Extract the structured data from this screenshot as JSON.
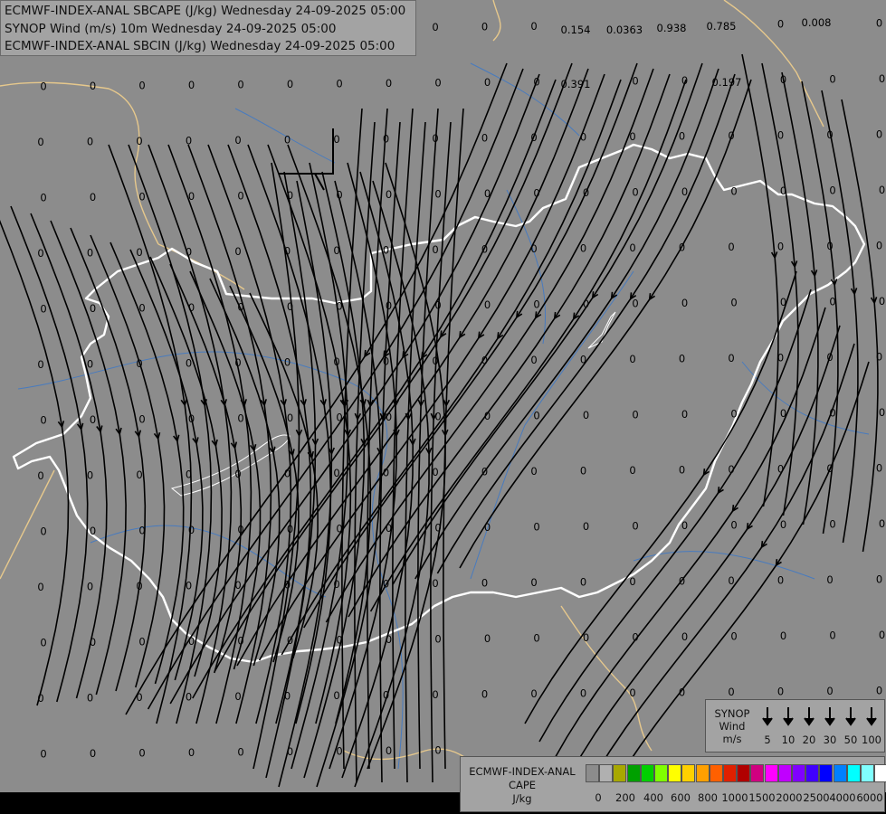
{
  "header": {
    "lines": [
      "ECMWF-INDEX-ANAL SBCAPE (J/kg) Wednesday 24-09-2025 05:00",
      "SYNOP Wind (m/s) 10m Wednesday 24-09-2025 05:00",
      "ECMWF-INDEX-ANAL SBCIN (J/kg) Wednesday 24-09-2025 05:00"
    ]
  },
  "wind_legend": {
    "title_lines": [
      "SYNOP",
      "Wind",
      "m/s"
    ],
    "speeds": [
      "5",
      "10",
      "20",
      "30",
      "50",
      "100"
    ]
  },
  "cape_legend": {
    "title_lines": [
      "ECMWF-INDEX-ANAL",
      "CAPE",
      "J/kg"
    ],
    "ticks": [
      "0",
      "200",
      "400",
      "600",
      "800",
      "1000",
      "1500",
      "2000",
      "2500",
      "4000",
      "6000"
    ],
    "colors": [
      "#8c8c8c",
      "#b0b0b0",
      "#a8a800",
      "#00a000",
      "#00d000",
      "#80ff00",
      "#ffff00",
      "#ffd000",
      "#ffa000",
      "#ff6000",
      "#e02000",
      "#b00000",
      "#d00080",
      "#ff00ff",
      "#c000ff",
      "#8000ff",
      "#4000ff",
      "#0000ff",
      "#0080ff",
      "#00ffff",
      "#80ffff",
      "#ffffff"
    ]
  },
  "map": {
    "colors": {
      "background": "#8c8c8c",
      "country_border": "#ffffff",
      "neighbor_border": "#e6c88c",
      "river": "#3c78c8",
      "streamline": "#000000",
      "bottom_strip": "#000000"
    },
    "value_labels": [
      "0",
      "0.154",
      "0.0363",
      "0.938",
      "0.785",
      "0.008",
      "0.391",
      "0.197"
    ]
  }
}
